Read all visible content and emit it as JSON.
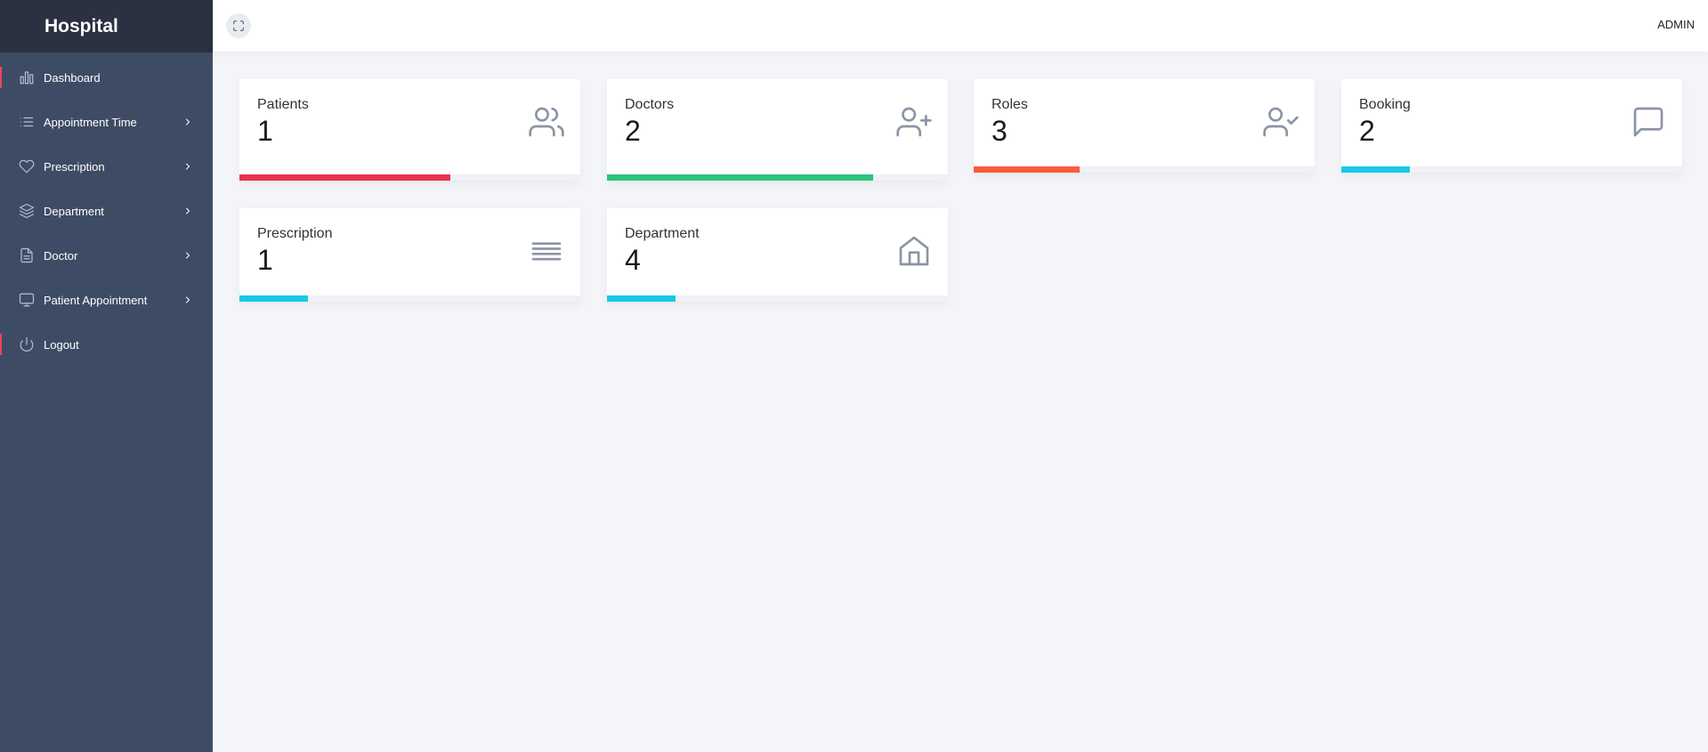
{
  "brand": {
    "title": "Hospital"
  },
  "sidebar": {
    "items": [
      {
        "label": "Dashboard",
        "icon": "bar-chart-icon",
        "submenu": false
      },
      {
        "label": "Appointment Time",
        "icon": "list-icon",
        "submenu": true
      },
      {
        "label": "Prescription",
        "icon": "heart-icon",
        "submenu": true
      },
      {
        "label": "Department",
        "icon": "layers-icon",
        "submenu": true
      },
      {
        "label": "Doctor",
        "icon": "file-text-icon",
        "submenu": true
      },
      {
        "label": "Patient Appointment",
        "icon": "monitor-icon",
        "submenu": true
      },
      {
        "label": "Logout",
        "icon": "power-icon",
        "submenu": false
      }
    ]
  },
  "topbar": {
    "user": "ADMIN",
    "expand_icon": "fullscreen-icon"
  },
  "cards": [
    {
      "label": "Patients",
      "value": "1",
      "icon": "users-icon",
      "progress_pct": 62,
      "color": "#e8334f"
    },
    {
      "label": "Doctors",
      "value": "2",
      "icon": "user-plus-icon",
      "progress_pct": 78,
      "color": "#2ec27e"
    },
    {
      "label": "Roles",
      "value": "3",
      "icon": "user-check-icon",
      "progress_pct": 31,
      "color": "#fa5c3c"
    },
    {
      "label": "Booking",
      "value": "2",
      "icon": "message-square-icon",
      "progress_pct": 20,
      "color": "#19c8e6"
    },
    {
      "label": "Prescription",
      "value": "1",
      "icon": "align-justify-icon",
      "progress_pct": 20,
      "color": "#19c8e6"
    },
    {
      "label": "Department",
      "value": "4",
      "icon": "home-icon",
      "progress_pct": 20,
      "color": "#19c8e6"
    }
  ]
}
